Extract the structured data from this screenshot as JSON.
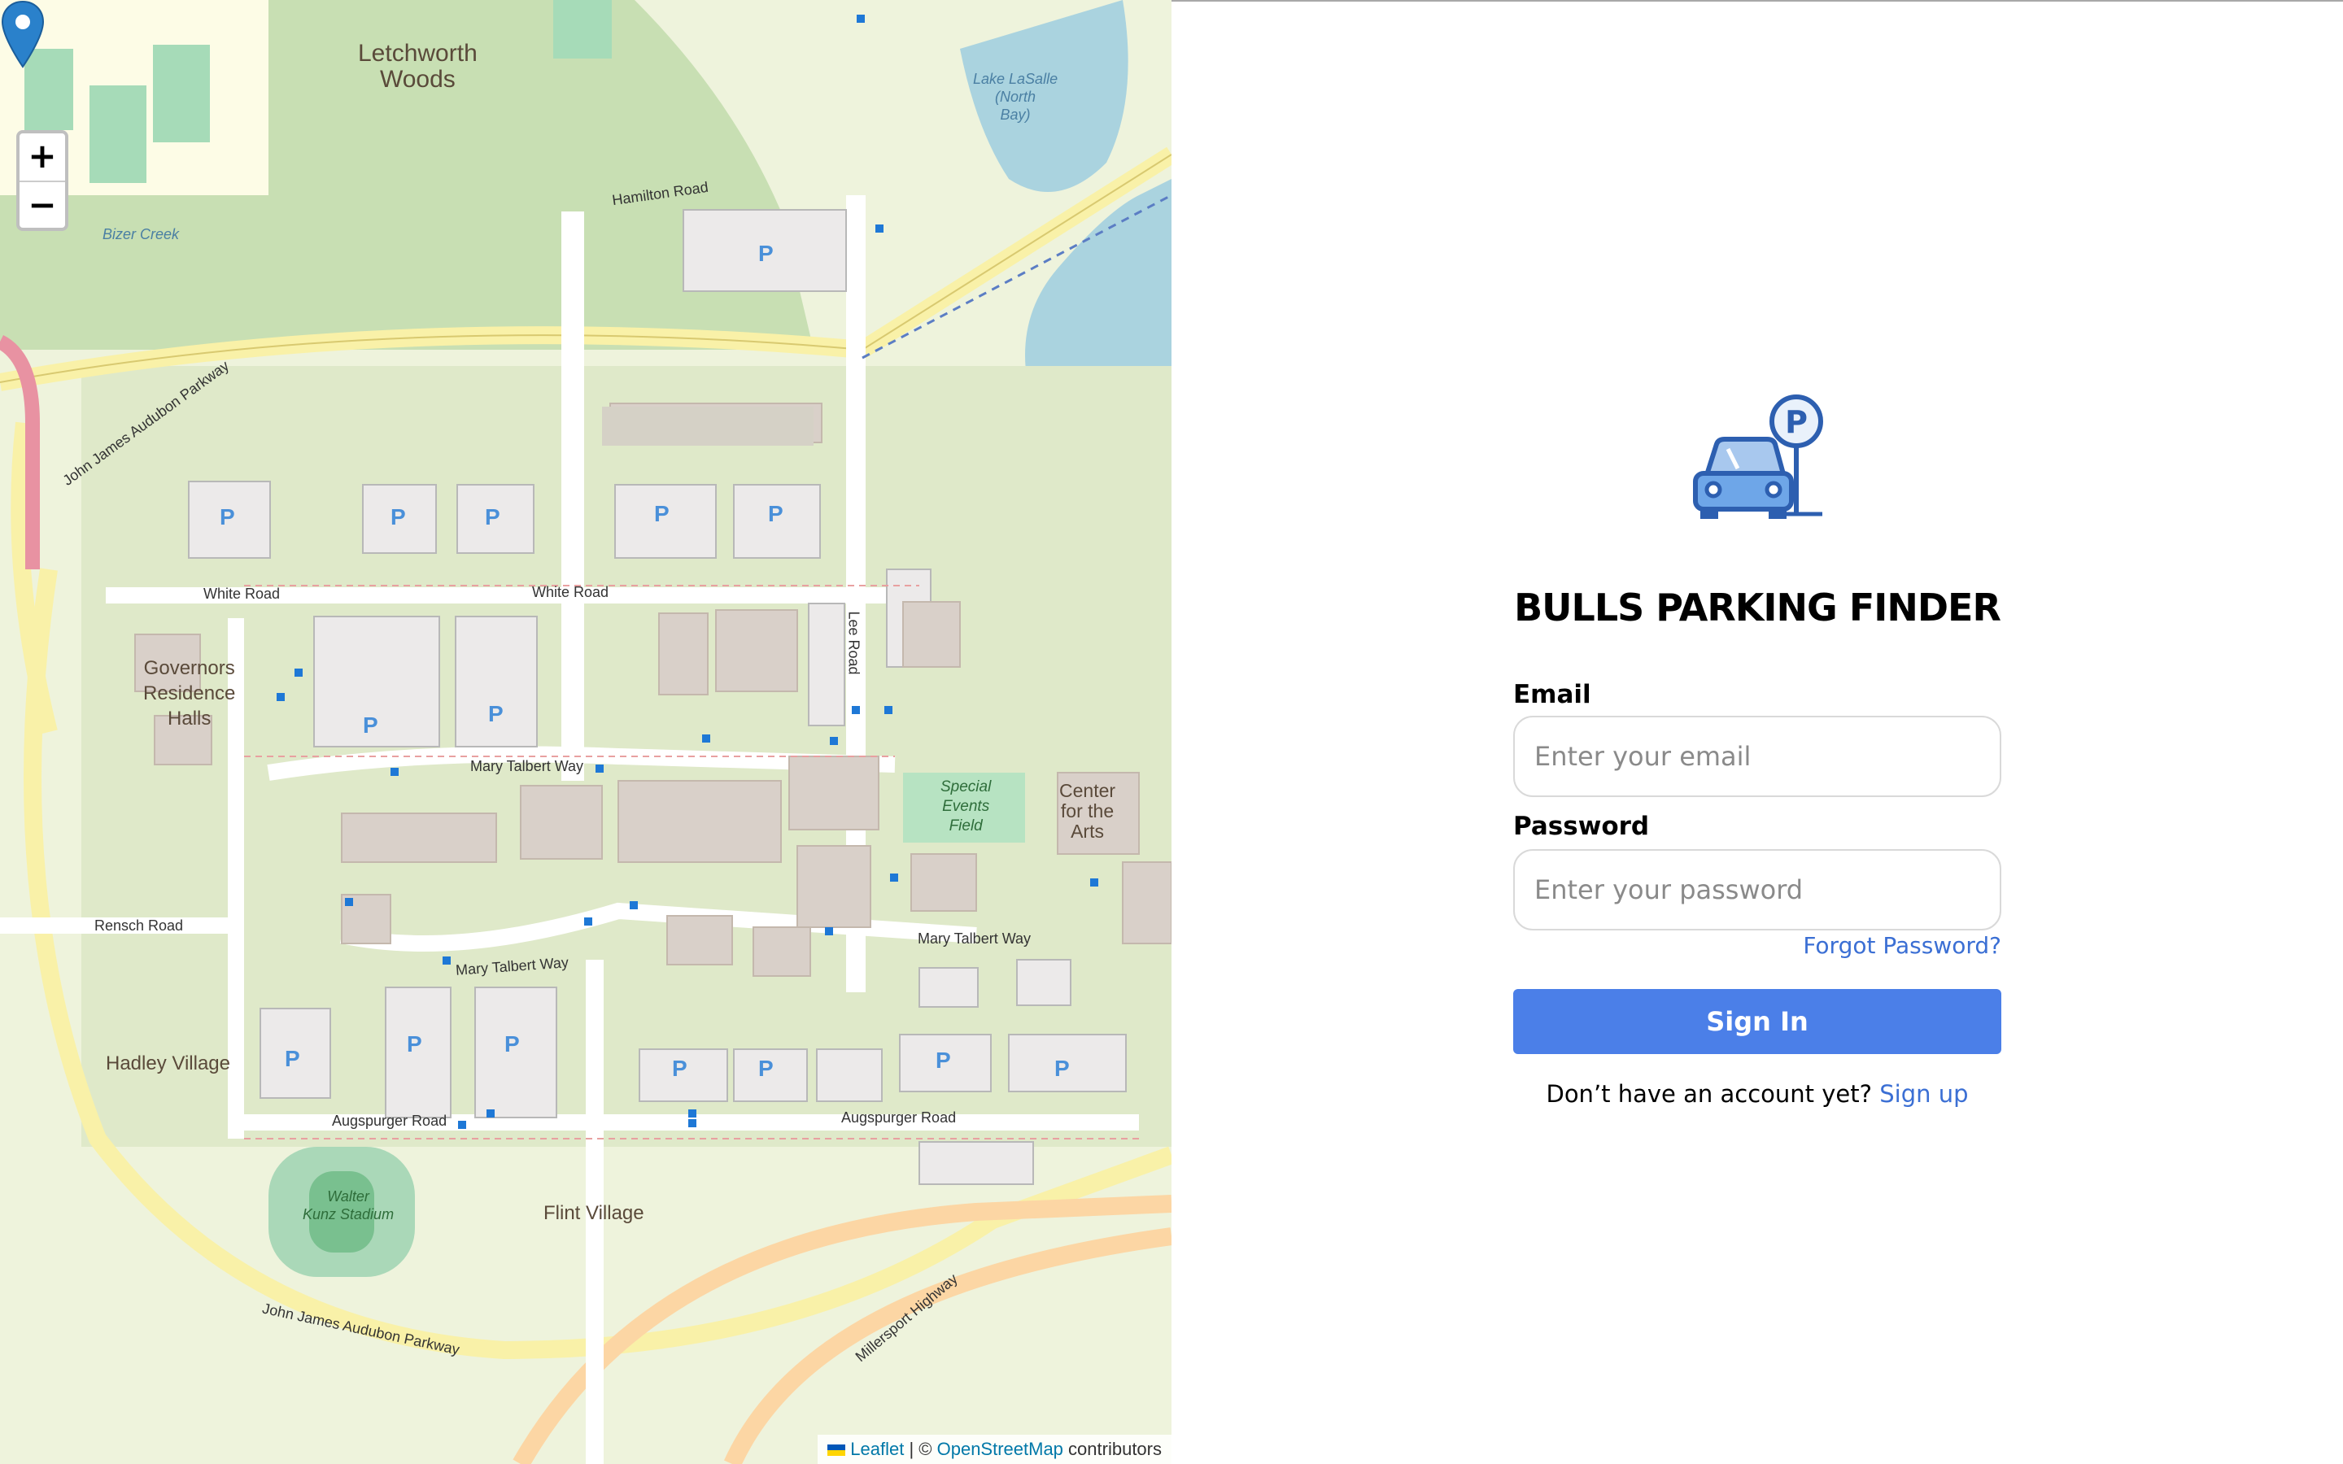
{
  "app": {
    "title": "BULLS PARKING FINDER"
  },
  "map": {
    "zoom_in_label": "+",
    "zoom_out_label": "−",
    "attribution": {
      "leaflet": "Leaflet",
      "separator": "| ©",
      "osm": "OpenStreetMap",
      "suffix": "contributors"
    },
    "labels": {
      "letchworth": "Letchworth\nWoods",
      "governors": "Governors\nResidence\nHalls",
      "hadley_village": "Hadley Village",
      "flint_village": "Flint Village",
      "special_events": "Special\nEvents\nField",
      "center_arts": "Center\nfor the\nArts",
      "walter_kunz": "Walter\nKunz Stadium",
      "hamilton_road": "Hamilton Road",
      "white_road_1": "White Road",
      "white_road_2": "White Road",
      "mary_talbert_1": "Mary Talbert Way",
      "mary_talbert_2": "Mary Talbert Way",
      "mary_talbert_3": "Mary Talbert Way",
      "rensch_road": "Rensch Road",
      "augspurger_1": "Augspurger Road",
      "augspurger_2": "Augspurger Road",
      "lee_road": "Lee Road",
      "jj_audubon": "John James Audubon Parkway",
      "jj_audubon_2": "John James Audubon Parkway",
      "millersport": "Millersport Highway",
      "bizer_creek": "Bizer Creek",
      "lake_lasalle": "Lake LaSalle\n(North\nBay)"
    }
  },
  "login": {
    "email_label": "Email",
    "email_placeholder": "Enter your email",
    "password_label": "Password",
    "password_placeholder": "Enter your password",
    "forgot_password": "Forgot Password?",
    "sign_in": "Sign In",
    "no_account": "Don’t have an account yet?",
    "sign_up": "Sign up"
  },
  "colors": {
    "accent": "#4b7fe8",
    "link": "#3b6fd4",
    "logo": "#2d5fb0"
  },
  "icons": {
    "logo": "car-parking-icon",
    "marker": "map-pin-icon"
  }
}
